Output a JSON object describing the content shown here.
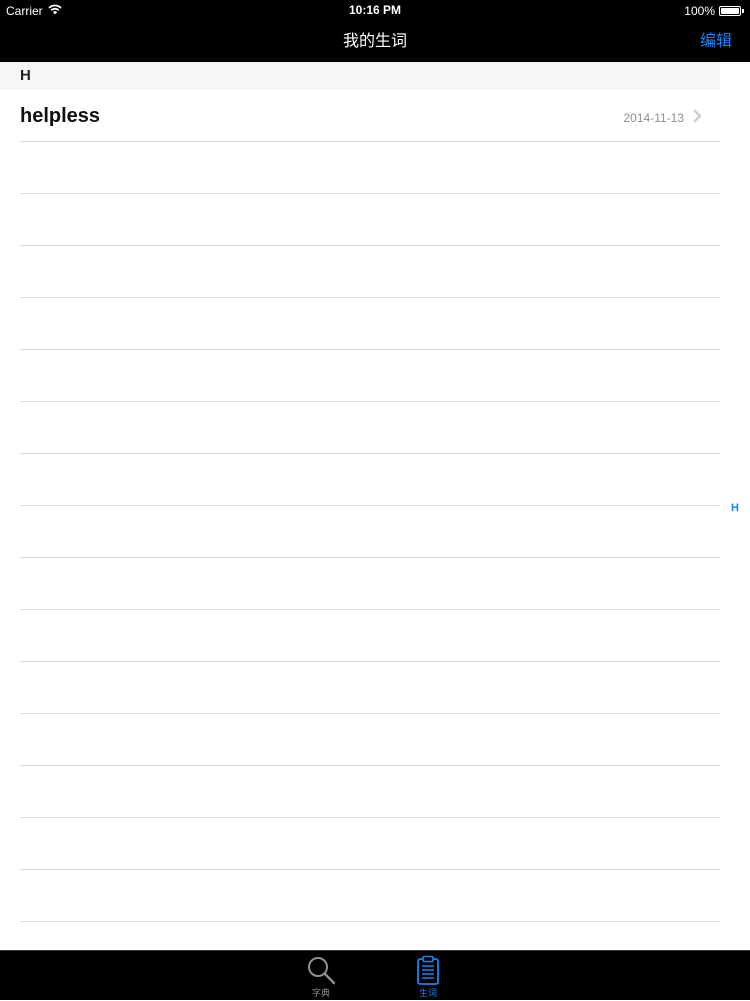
{
  "status_bar": {
    "carrier": "Carrier",
    "time": "10:16 PM",
    "battery": "100%",
    "battery_level": 1.0
  },
  "nav": {
    "title": "我的生词",
    "edit_label": "编辑"
  },
  "section": {
    "title": "H"
  },
  "words": [
    {
      "word": "helpless",
      "date": "2014-11-13"
    }
  ],
  "section_index": [
    "H"
  ],
  "tabs": [
    {
      "label": "字典",
      "icon": "magnifier-icon",
      "active": false
    },
    {
      "label": "生词",
      "icon": "clipboard-icon",
      "active": true
    }
  ],
  "colors": {
    "accent": "#1a82f0",
    "bar_background": "#000000",
    "inactive_tab": "#8e8e93"
  }
}
